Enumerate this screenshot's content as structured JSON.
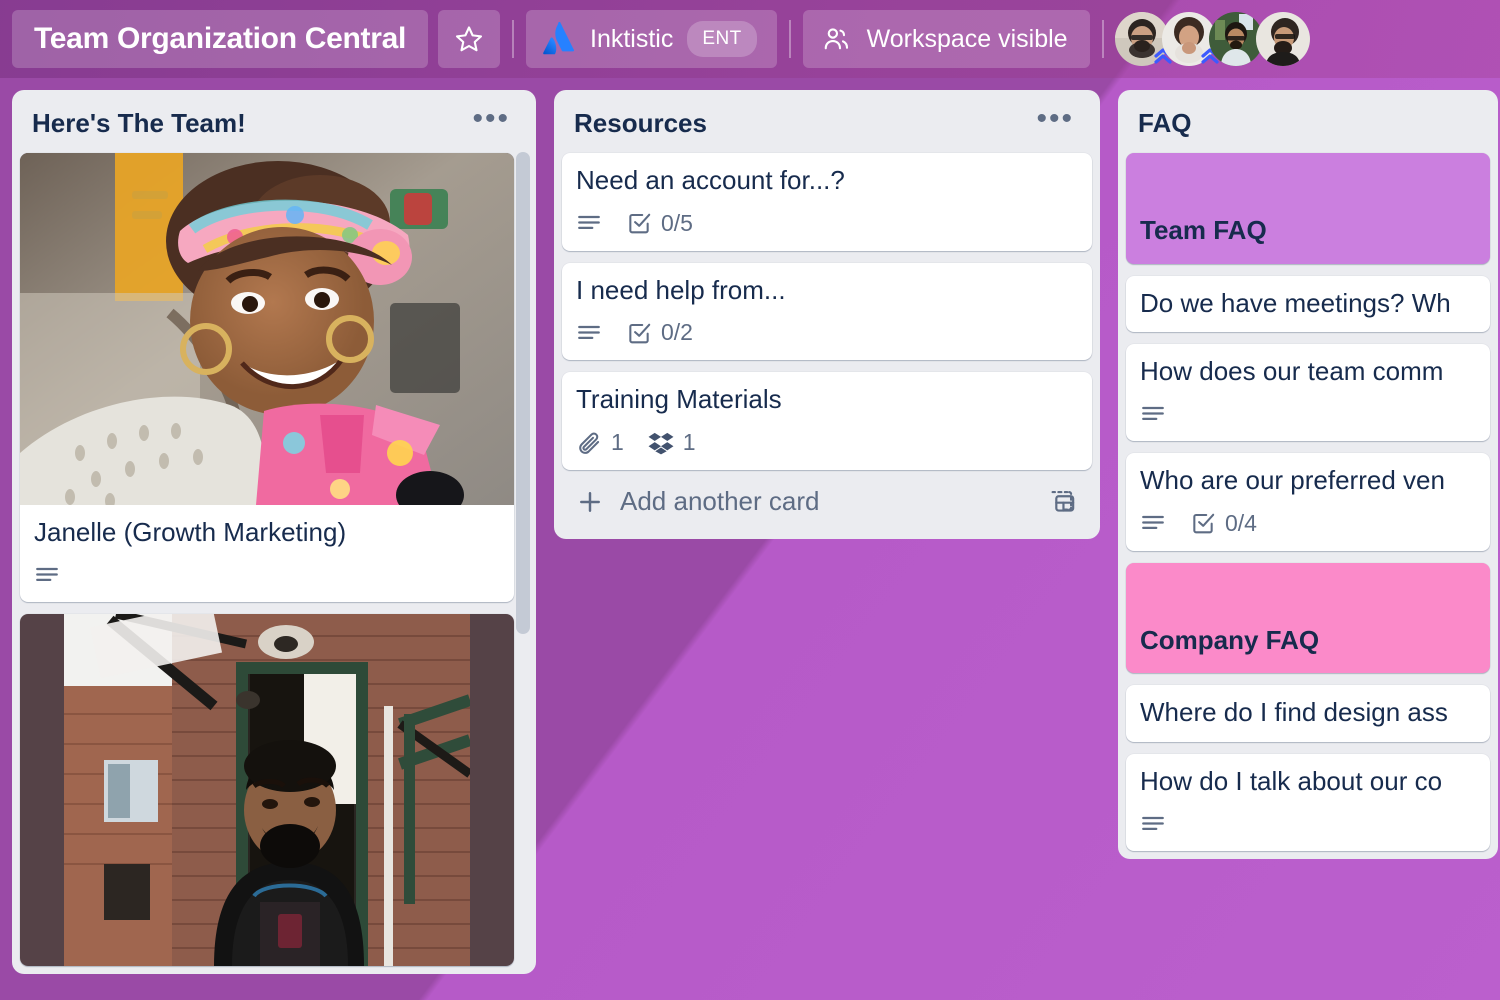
{
  "header": {
    "board_title": "Team Organization Central",
    "star_icon": "star-icon",
    "workspace": {
      "logo_icon": "atlassian-logo-icon",
      "name": "Inktistic",
      "plan_badge": "ENT"
    },
    "visibility": {
      "icon": "workspace-visible-icon",
      "label": "Workspace visible"
    },
    "members": [
      {
        "name": "member-1",
        "badge": "premium-chevrons-badge"
      },
      {
        "name": "member-2",
        "badge": "premium-chevrons-badge"
      },
      {
        "name": "member-3",
        "badge": ""
      },
      {
        "name": "member-4",
        "badge": ""
      }
    ]
  },
  "lists": [
    {
      "title": "Here's The Team!",
      "menu_icon": "list-menu-icon",
      "cards": [
        {
          "title": "Janelle (Growth Marketing)",
          "cover": "photo-woman-headscarf",
          "badges": [
            {
              "icon": "description-icon",
              "text": ""
            }
          ]
        },
        {
          "title": "",
          "cover": "photo-man-brick-building",
          "badges": []
        }
      ]
    },
    {
      "title": "Resources",
      "menu_icon": "list-menu-icon",
      "cards": [
        {
          "title": "Need an account for...?",
          "cover": "",
          "badges": [
            {
              "icon": "description-icon",
              "text": ""
            },
            {
              "icon": "checklist-icon",
              "text": "0/5"
            }
          ]
        },
        {
          "title": "I need help from...",
          "cover": "",
          "badges": [
            {
              "icon": "description-icon",
              "text": ""
            },
            {
              "icon": "checklist-icon",
              "text": "0/2"
            }
          ]
        },
        {
          "title": "Training Materials",
          "cover": "",
          "badges": [
            {
              "icon": "attachment-icon",
              "text": "1"
            },
            {
              "icon": "dropbox-icon",
              "text": "1"
            }
          ]
        }
      ],
      "add_card": {
        "label": "Add another card",
        "plus_icon": "plus-icon",
        "template_icon": "card-template-icon"
      }
    },
    {
      "title": "FAQ",
      "menu_icon": "list-menu-icon",
      "cards": [
        {
          "title": "Team FAQ",
          "cover_color": "#cb7fdf",
          "badges": []
        },
        {
          "title": "Do we have meetings? Wh",
          "cover_color": "",
          "badges": []
        },
        {
          "title": "How does our team comm",
          "cover_color": "",
          "badges": [
            {
              "icon": "description-icon",
              "text": ""
            }
          ]
        },
        {
          "title": "Who are our preferred ven",
          "cover_color": "",
          "badges": [
            {
              "icon": "description-icon",
              "text": ""
            },
            {
              "icon": "checklist-icon",
              "text": "0/4"
            }
          ]
        },
        {
          "title": "Company FAQ",
          "cover_color": "#fb8ac9",
          "badges": []
        },
        {
          "title": "Where do I find design ass",
          "cover_color": "",
          "badges": []
        },
        {
          "title": "How do I talk about our co",
          "cover_color": "",
          "badges": [
            {
              "icon": "description-icon",
              "text": ""
            }
          ]
        }
      ]
    }
  ],
  "colors": {
    "board_background_dark": "#9a4aa6",
    "board_background_light": "#b65ac8",
    "list_background": "#ebecf0",
    "card_background": "#ffffff",
    "text_primary": "#172b4d",
    "text_muted": "#5e6c84",
    "cover_purple": "#cb7fdf",
    "cover_pink": "#fb8ac9",
    "atlassian_blue": "#2684ff"
  }
}
